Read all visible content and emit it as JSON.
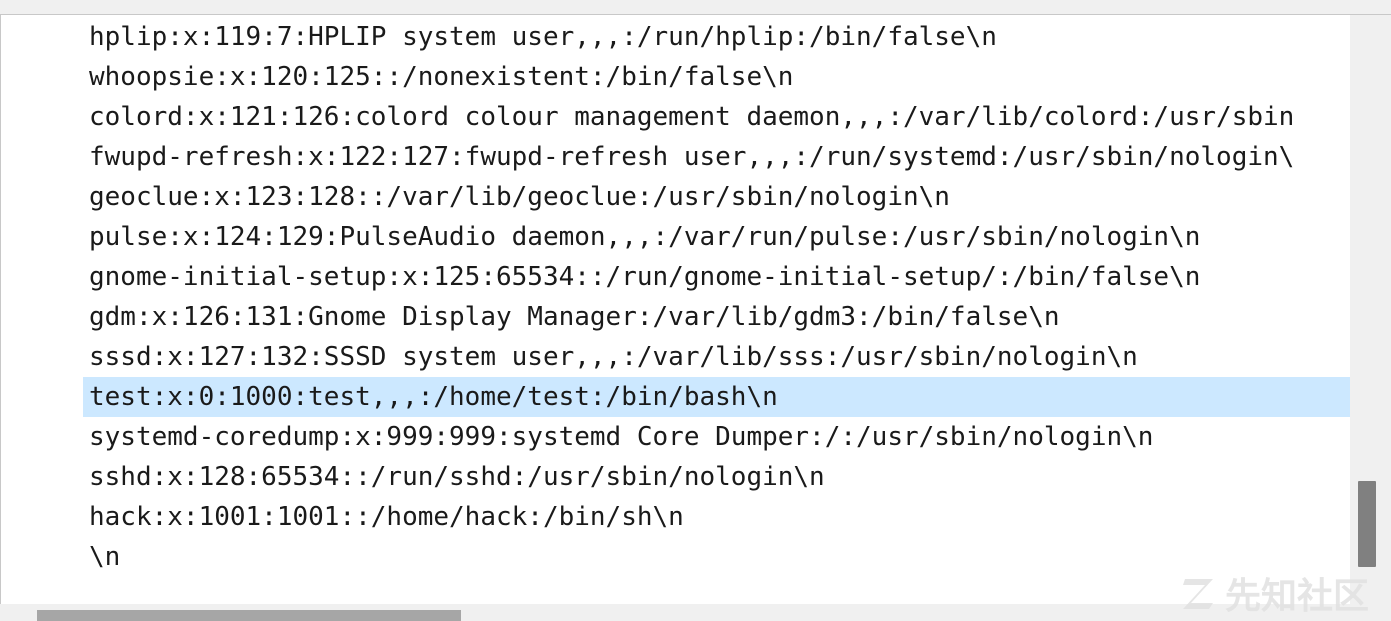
{
  "editor": {
    "lines": [
      "hplip:x:119:7:HPLIP system user,,,:/run/hplip:/bin/false\\n",
      "whoopsie:x:120:125::/nonexistent:/bin/false\\n",
      "colord:x:121:126:colord colour management daemon,,,:/var/lib/colord:/usr/sbin",
      "fwupd-refresh:x:122:127:fwupd-refresh user,,,:/run/systemd:/usr/sbin/nologin\\",
      "geoclue:x:123:128::/var/lib/geoclue:/usr/sbin/nologin\\n",
      "pulse:x:124:129:PulseAudio daemon,,,:/var/run/pulse:/usr/sbin/nologin\\n",
      "gnome-initial-setup:x:125:65534::/run/gnome-initial-setup/:/bin/false\\n",
      "gdm:x:126:131:Gnome Display Manager:/var/lib/gdm3:/bin/false\\n",
      "sssd:x:127:132:SSSD system user,,,:/var/lib/sss:/usr/sbin/nologin\\n",
      "test:x:0:1000:test,,,:/home/test:/bin/bash\\n",
      "systemd-coredump:x:999:999:systemd Core Dumper:/:/usr/sbin/nologin\\n",
      "sshd:x:128:65534::/run/sshd:/usr/sbin/nologin\\n",
      "hack:x:1001:1001::/home/hack:/bin/sh\\n",
      "\\n"
    ],
    "selected_line": 9
  },
  "watermark": {
    "text": "先知社区",
    "icon": "z-logo-icon"
  }
}
